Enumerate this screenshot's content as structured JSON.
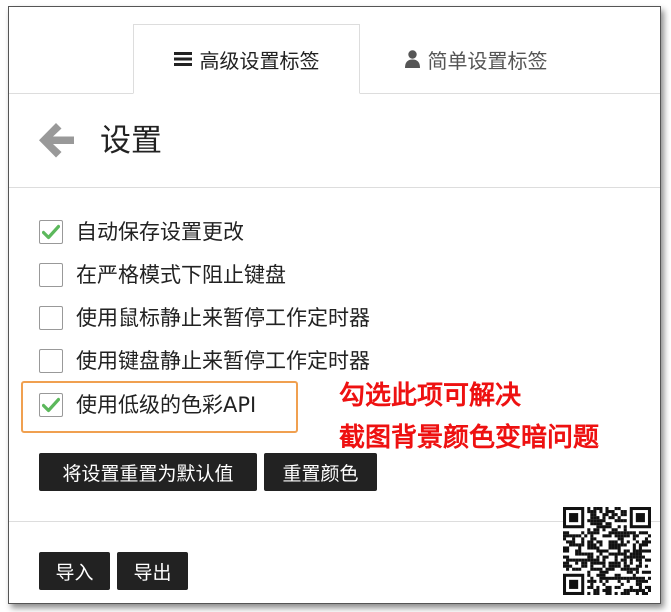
{
  "tabs": {
    "advanced": {
      "label": "高级设置标签",
      "icon": "hamburger-menu-icon"
    },
    "simple": {
      "label": "简单设置标签",
      "icon": "user-icon"
    }
  },
  "header": {
    "title": "设置",
    "back_icon": "back-arrow-icon"
  },
  "options": [
    {
      "label": "自动保存设置更改",
      "checked": true
    },
    {
      "label": "在严格模式下阻止键盘",
      "checked": false
    },
    {
      "label": "使用鼠标静止来暂停工作定时器",
      "checked": false
    },
    {
      "label": "使用键盘静止来暂停工作定时器",
      "checked": false
    },
    {
      "label": "使用低级的色彩API",
      "checked": true
    }
  ],
  "annotation": {
    "line1": "勾选此项可解决",
    "line2": "截图背景颜色变暗问题",
    "color": "#ee1111"
  },
  "buttons": {
    "reset_default": "将设置重置为默认值",
    "reset_colors": "重置颜色",
    "import": "导入",
    "export": "导出"
  },
  "colors": {
    "checkmark": "#5cb85c",
    "highlight_border": "#f0a050",
    "button_bg": "#222222",
    "back_arrow": "#999999"
  }
}
